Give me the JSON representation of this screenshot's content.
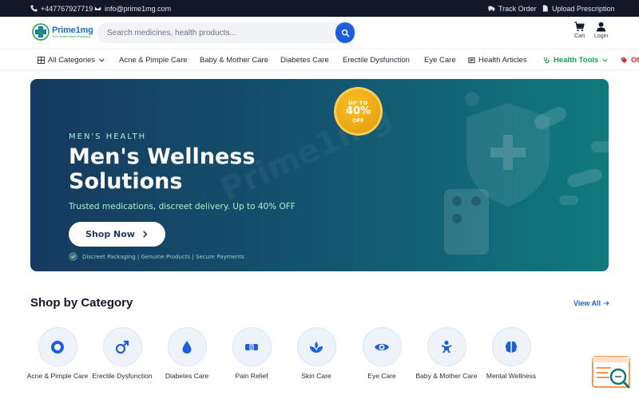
{
  "topbar": {
    "phone": "+447767927719",
    "email": "info@prime1mg.com",
    "track_order": "Track Order",
    "upload_prescription": "Upload Prescription"
  },
  "header": {
    "logo_name": "Prime1mg",
    "logo_tagline": "Your Trusted Online Pharmacy",
    "search_placeholder": "Search medicines, health products...",
    "cart_label": "Cart",
    "login_label": "Login"
  },
  "nav": {
    "all_categories": "All Categories",
    "items": [
      "Acne & Pimple Care",
      "Baby & Mother Care",
      "Diabetes Care",
      "Erectile Dysfunction",
      "Eye Care"
    ],
    "health_articles": "Health Articles",
    "health_tools": "Health Tools",
    "offers": "Offers"
  },
  "hero": {
    "eyebrow": "MEN'S HEALTH",
    "title": "Men's Wellness Solutions",
    "subtitle": "Trusted medications, discreet delivery. Up to 40% OFF",
    "cta": "Shop Now",
    "trust": "Discreet Packaging | Genuine Products | Secure Payments",
    "badge_top": "UP TO",
    "badge_value": "40%",
    "badge_bottom": "OFF",
    "watermark": "Prime1mg"
  },
  "categories": {
    "title": "Shop by Category",
    "view_all": "View All",
    "items": [
      {
        "label": "Acne & Pimple Care",
        "icon": "dot-circle-icon"
      },
      {
        "label": "Erectile Dysfunction",
        "icon": "mars-icon"
      },
      {
        "label": "Diabetes Care",
        "icon": "droplet-icon"
      },
      {
        "label": "Pain Relief",
        "icon": "bandage-icon"
      },
      {
        "label": "Skin Care",
        "icon": "spa-icon"
      },
      {
        "label": "Eye Care",
        "icon": "eye-icon"
      },
      {
        "label": "Baby & Mother Care",
        "icon": "baby-icon"
      },
      {
        "label": "Mental Wellness",
        "icon": "brain-icon"
      }
    ]
  },
  "colors": {
    "brand_blue": "#1d5fd8",
    "brand_green": "#16a34a",
    "topbar": "#111827",
    "hero_start": "#163a5f",
    "hero_end": "#107a7f",
    "badge": "#f2b01e"
  }
}
